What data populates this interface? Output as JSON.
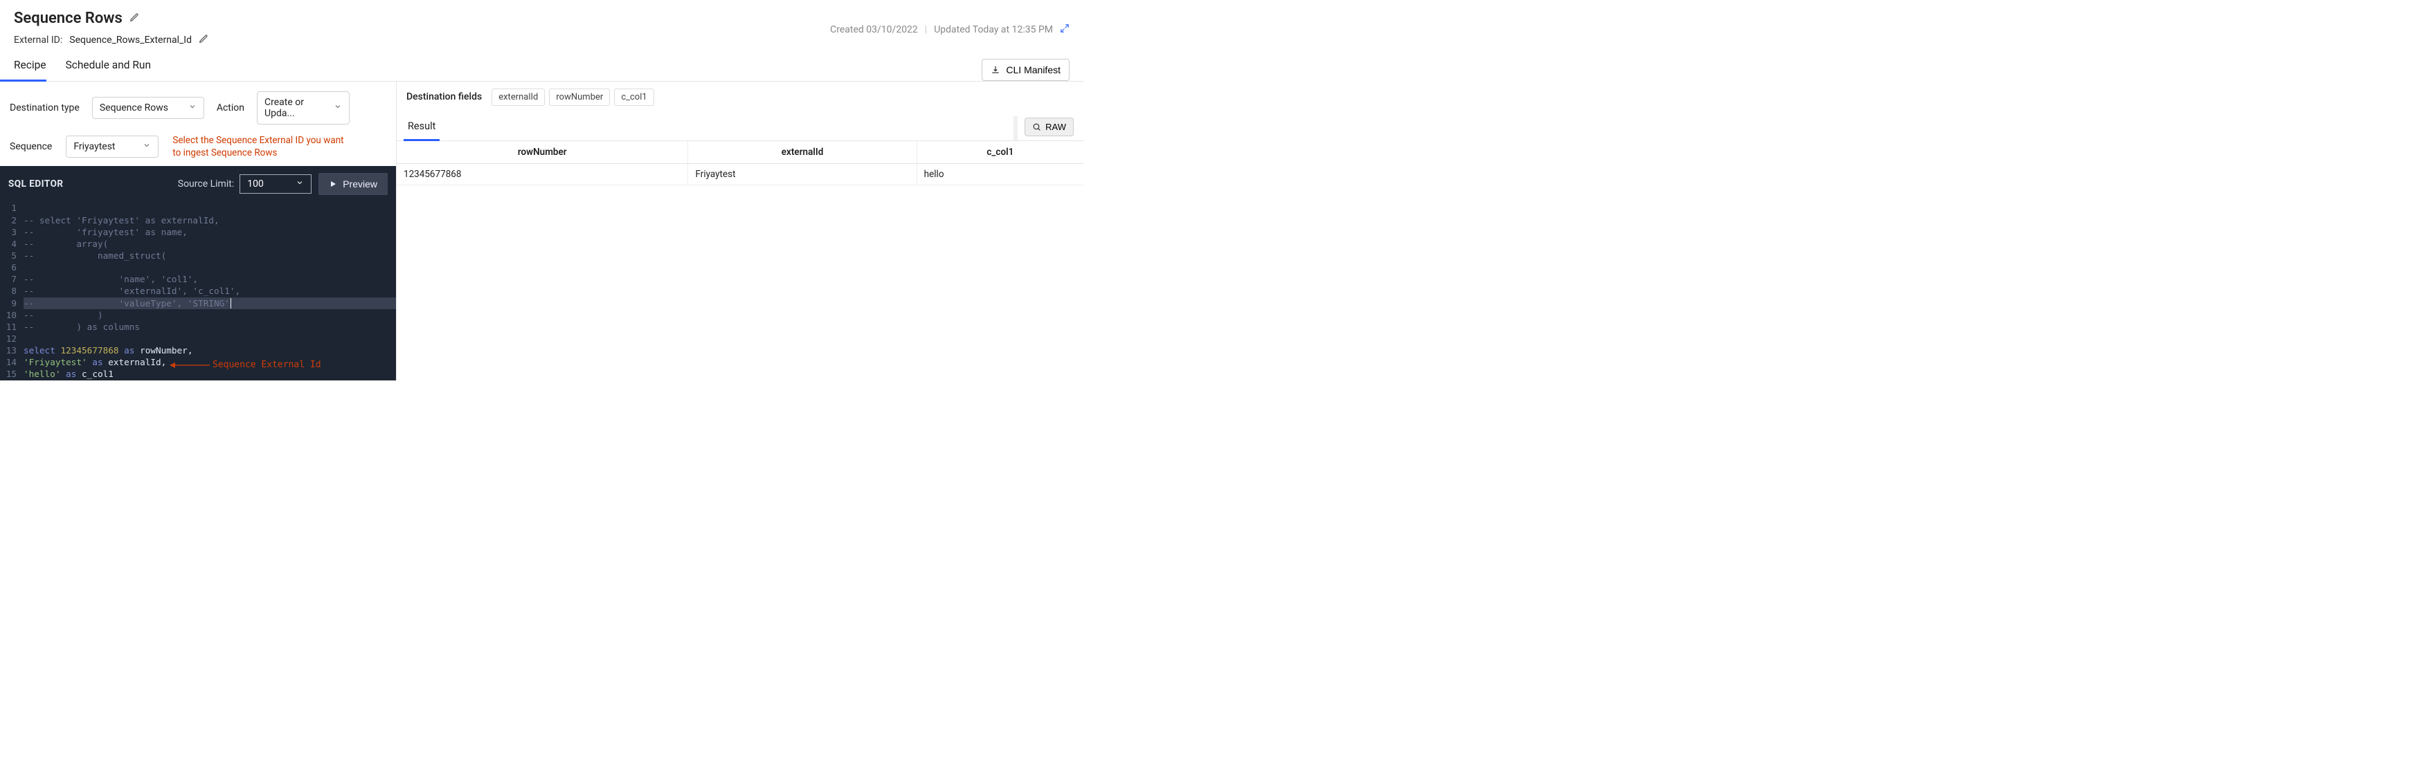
{
  "header": {
    "title": "Sequence Rows",
    "external_id_label": "External ID:",
    "external_id_value": "Sequence_Rows_External_Id",
    "created_label": "Created 03/10/2022",
    "updated_label": "Updated Today at 12:35 PM"
  },
  "tabs": {
    "recipe": "Recipe",
    "schedule": "Schedule and Run",
    "cli_button": "CLI Manifest"
  },
  "controls": {
    "dest_type_label": "Destination type",
    "dest_type_value": "Sequence Rows",
    "action_label": "Action",
    "action_value": "Create or Upda...",
    "sequence_label": "Sequence",
    "sequence_value": "Friyaytest",
    "hint": "Select the Sequence External ID you want to ingest Sequence Rows"
  },
  "sql_editor": {
    "title": "SQL EDITOR",
    "source_limit_label": "Source Limit:",
    "source_limit_value": "100",
    "preview_label": "Preview",
    "annotation": "Sequence External Id",
    "code_lines": [
      {
        "n": "1",
        "comment": ""
      },
      {
        "n": "2",
        "comment": "-- select 'Friyaytest' as externalId,"
      },
      {
        "n": "3",
        "comment": "--        'friyaytest' as name,"
      },
      {
        "n": "4",
        "caret": true,
        "comment": "--        array("
      },
      {
        "n": "5",
        "caret": true,
        "comment": "--            named_struct("
      },
      {
        "n": "6",
        "comment": ""
      },
      {
        "n": "7",
        "comment": "--                'name', 'col1',"
      },
      {
        "n": "8",
        "comment": "--                'externalId', 'c_col1',"
      },
      {
        "n": "9",
        "hl": true,
        "comment": "--                'valueType', 'STRING'",
        "cursor_after": true
      },
      {
        "n": "10",
        "comment": "--            )"
      },
      {
        "n": "11",
        "comment": "--        ) as columns"
      },
      {
        "n": "12",
        "comment": ""
      },
      {
        "n": "13",
        "select_row": {
          "kw": "select ",
          "num": "12345677868",
          "as": " as ",
          "id": "rowNumber",
          "tail": ","
        }
      },
      {
        "n": "14",
        "str_row": {
          "str": "'Friyaytest'",
          "as": " as ",
          "id": "externalId",
          "tail": ","
        }
      },
      {
        "n": "15",
        "str_row": {
          "str": "'hello'",
          "as": " as ",
          "id": "c_col1",
          "tail": ""
        }
      }
    ]
  },
  "results": {
    "dest_fields_label": "Destination fields",
    "chips": [
      "externalId",
      "rowNumber",
      "c_col1"
    ],
    "result_tab": "Result",
    "raw_button": "RAW",
    "columns": [
      "rowNumber",
      "externalId",
      "c_col1"
    ],
    "rows": [
      {
        "rowNumber": "12345677868",
        "externalId": "Friyaytest",
        "c_col1": "hello"
      }
    ]
  }
}
